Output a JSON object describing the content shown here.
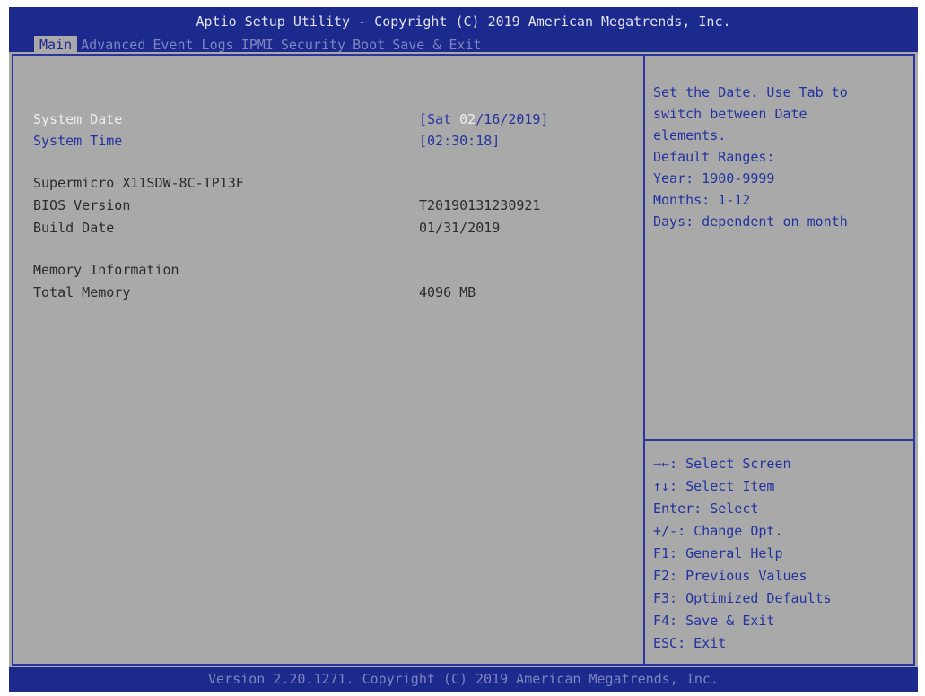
{
  "header": {
    "title": "Aptio Setup Utility - Copyright (C) 2019 American Megatrends, Inc.",
    "tabs": [
      {
        "label": "Main",
        "active": true
      },
      {
        "label": "Advanced",
        "active": false
      },
      {
        "label": "Event Logs",
        "active": false
      },
      {
        "label": "IPMI",
        "active": false
      },
      {
        "label": "Security",
        "active": false
      },
      {
        "label": "Boot",
        "active": false
      },
      {
        "label": "Save & Exit",
        "active": false
      }
    ]
  },
  "main": {
    "system_date": {
      "label": "System Date",
      "value_prefix": "[Sat ",
      "value_highlight": "02",
      "value_suffix": "/16/2019]"
    },
    "system_time": {
      "label": "System Time",
      "value": "[02:30:18]"
    },
    "board_model": "Supermicro X11SDW-8C-TP13F",
    "bios_version": {
      "label": "BIOS Version",
      "value": "T20190131230921"
    },
    "build_date": {
      "label": "Build Date",
      "value": "01/31/2019"
    },
    "memory_heading": "Memory Information",
    "total_memory": {
      "label": "Total Memory",
      "value": "4096 MB"
    }
  },
  "help": {
    "description": [
      "Set the Date. Use Tab to",
      "switch between Date",
      "elements.",
      "Default Ranges:",
      "Year: 1900-9999",
      "Months: 1-12",
      "Days: dependent on month"
    ],
    "keys": [
      "→←: Select Screen",
      "↑↓: Select Item",
      "Enter: Select",
      "+/-: Change Opt.",
      "F1: General Help",
      "F2: Previous Values",
      "F3: Optimized Defaults",
      "F4: Save & Exit",
      "ESC: Exit"
    ]
  },
  "footer": {
    "text": "Version 2.20.1271. Copyright (C) 2019 American Megatrends, Inc."
  },
  "colors": {
    "title_bar": "#1c2a8e",
    "panel_bg": "#a9a9a9",
    "link_text": "#2233a0",
    "border": "#2b35a0"
  }
}
